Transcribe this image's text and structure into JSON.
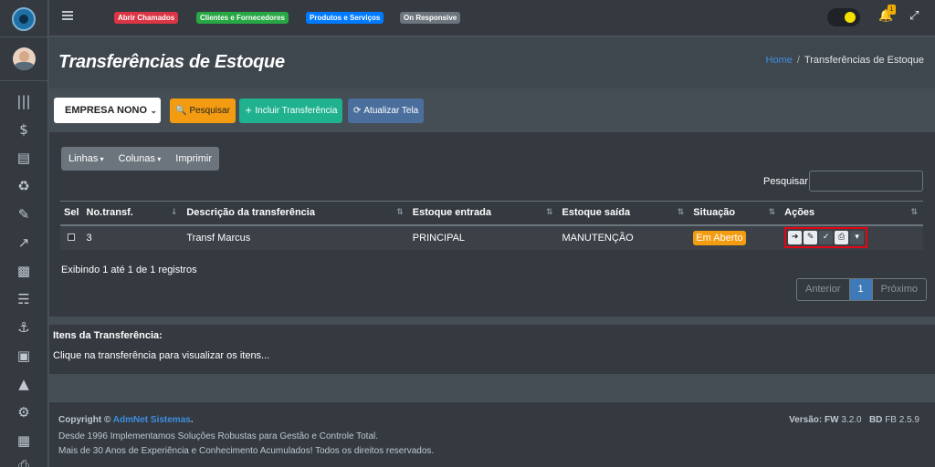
{
  "navbar": {
    "badges": [
      {
        "label": "Abrir Chamados",
        "color": "#dc3545"
      },
      {
        "label": "Clientes e Fornecedores",
        "color": "#28a745"
      },
      {
        "label": "Produtos e Serviços",
        "color": "#007bff"
      },
      {
        "label": "On Responsive",
        "color": "#6c757d"
      }
    ],
    "notification_count": "1"
  },
  "header": {
    "title": "Transferências de Estoque",
    "breadcrumb_home": "Home",
    "breadcrumb_current": "Transferências de Estoque"
  },
  "toolbar": {
    "empresa_selected": "EMPRESA NONO",
    "pesquisar": "Pesquisar",
    "incluir": "Incluir Transferência",
    "atualizar": "Atualizar Tela"
  },
  "table_tools": {
    "linhas": "Linhas",
    "colunas": "Colunas",
    "imprimir": "Imprimir",
    "search_label": "Pesquisar"
  },
  "table": {
    "columns": [
      "Sel",
      "No.transf.",
      "Descrição da transferência",
      "Estoque entrada",
      "Estoque saída",
      "Situação",
      "Ações"
    ],
    "rows": [
      {
        "no": "3",
        "descricao": "Transf Marcus",
        "entrada": "PRINCIPAL",
        "saida": "MANUTENÇÃO",
        "situacao": "Em Aberto"
      }
    ],
    "info": "Exibindo 1 até 1 de 1 registros",
    "pager": {
      "prev": "Anterior",
      "page": "1",
      "next": "Próximo"
    }
  },
  "items": {
    "title": "Itens da Transferência:",
    "subtitle": "Clique na transferência para visualizar os itens..."
  },
  "footer": {
    "copyright_prefix": "Copyright ©",
    "brand": "AdmNet Sistemas",
    "brand_suffix": ".",
    "line2": "Desde 1996 Implementamos Soluções Robustas para Gestão e Controle Total.",
    "line3": "Mais de 30 Anos de Experiência e Conhecimento Acumulados! Todos os direitos reservados.",
    "version_label": "Versão: FW",
    "version_value": "3.2.0",
    "bd_label": "BD",
    "bd_value": "FB 2.5.9"
  },
  "colors": {
    "accent_blue": "#3f8ee0",
    "status_open": "#f39c12",
    "highlight_red": "#e30613"
  }
}
